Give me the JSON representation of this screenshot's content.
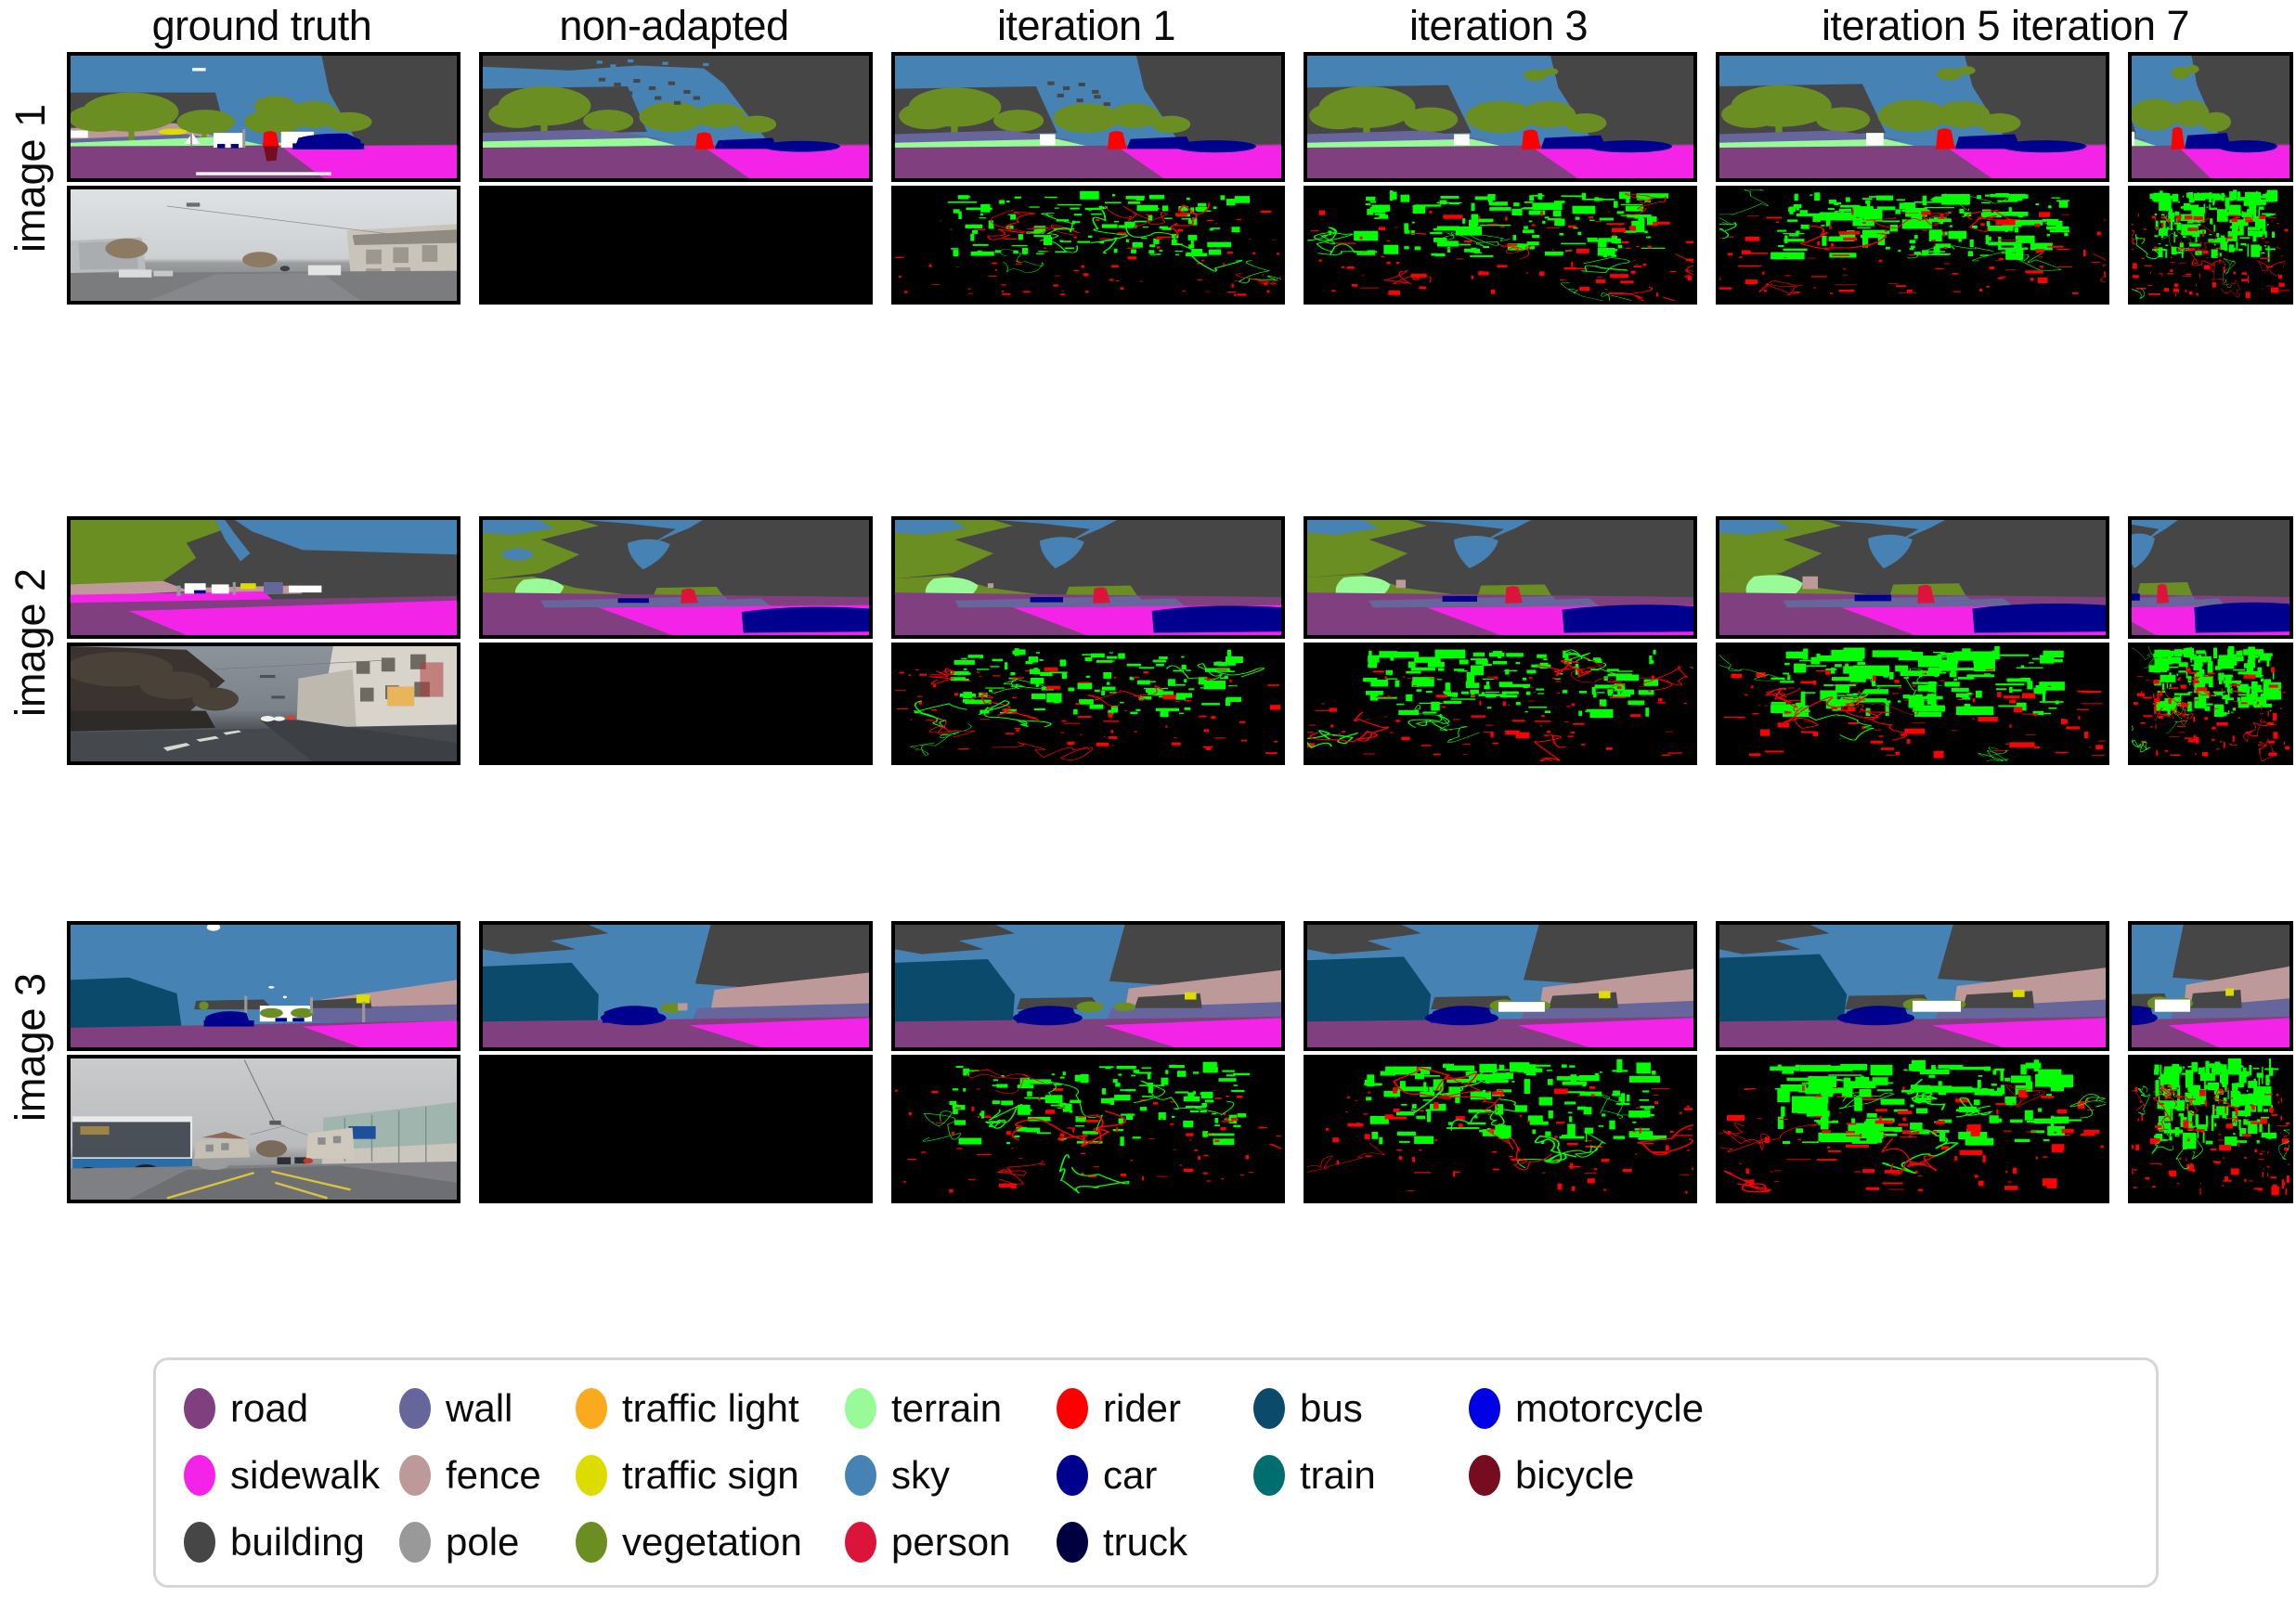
{
  "figure": {
    "type": "qualitative-results-grid",
    "columns": [
      {
        "label": "ground truth"
      },
      {
        "label": "non-adapted"
      },
      {
        "label": "iteration 1"
      },
      {
        "label": "iteration 3"
      },
      {
        "label": "iteration 5"
      },
      {
        "label": "iteration 7"
      }
    ],
    "row_groups": [
      {
        "label": "image 1"
      },
      {
        "label": "image 2"
      },
      {
        "label": "image 3"
      }
    ],
    "row_kinds": [
      "segmentation",
      "error-map",
      "segmentation",
      "error-map",
      "segmentation",
      "error-map"
    ]
  },
  "error_map": {
    "correct_color": "#00FF00",
    "incorrect_color": "#FF0000",
    "background_color": "#000000"
  },
  "legend": {
    "border_color": "#D6D6D6",
    "classes": [
      {
        "name": "road",
        "color": "#804080"
      },
      {
        "name": "sidewalk",
        "color": "#F423E8"
      },
      {
        "name": "building",
        "color": "#464646"
      },
      {
        "name": "wall",
        "color": "#66669C"
      },
      {
        "name": "fence",
        "color": "#BE9999"
      },
      {
        "name": "pole",
        "color": "#999999"
      },
      {
        "name": "traffic light",
        "color": "#FAAA1E"
      },
      {
        "name": "traffic sign",
        "color": "#DCDC00"
      },
      {
        "name": "vegetation",
        "color": "#6B8E23"
      },
      {
        "name": "terrain",
        "color": "#98FB98"
      },
      {
        "name": "sky",
        "color": "#4682B4"
      },
      {
        "name": "person",
        "color": "#DC143C"
      },
      {
        "name": "rider",
        "color": "#FF0000"
      },
      {
        "name": "car",
        "color": "#00008E"
      },
      {
        "name": "truck",
        "color": "#000040"
      },
      {
        "name": "bus",
        "color": "#0B4A6B"
      },
      {
        "name": "train",
        "color": "#006E6E"
      },
      {
        "name": "motorcycle",
        "color": "#0000E6"
      },
      {
        "name": "bicycle",
        "color": "#770B20"
      }
    ],
    "column_order": [
      [
        "road",
        "sidewalk",
        "building"
      ],
      [
        "wall",
        "fence",
        "pole"
      ],
      [
        "traffic light",
        "traffic sign",
        "vegetation"
      ],
      [
        "terrain",
        "sky",
        "person"
      ],
      [
        "rider",
        "car",
        "truck"
      ],
      [
        "bus",
        "train",
        ""
      ],
      [
        "motorcycle",
        "bicycle",
        ""
      ]
    ]
  }
}
